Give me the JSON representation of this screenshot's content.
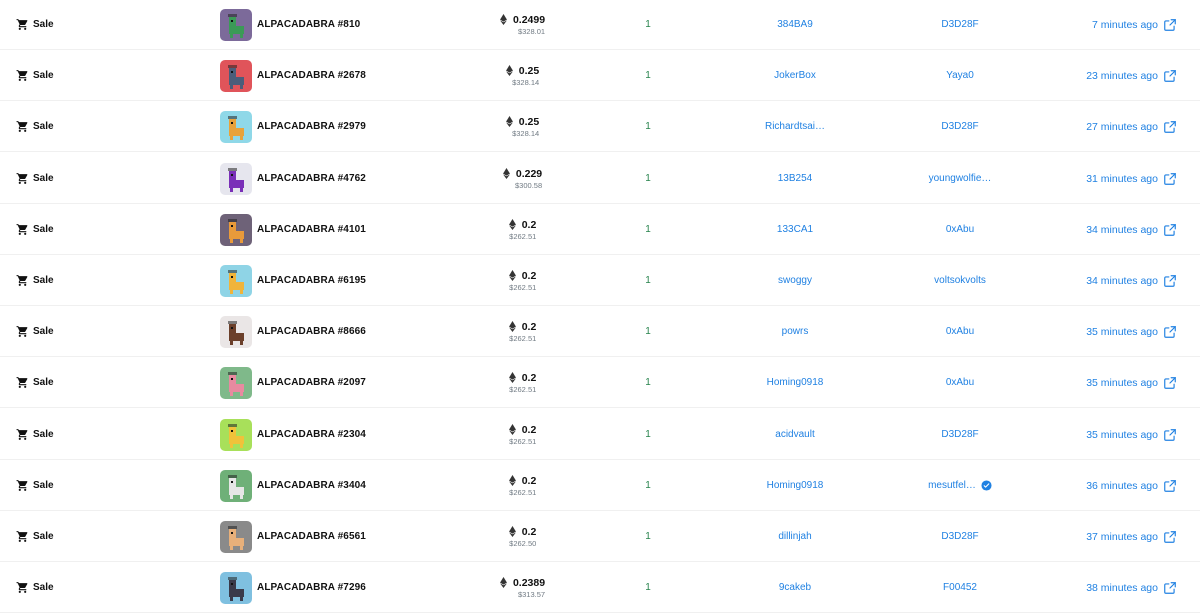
{
  "event_label": "Sale",
  "colors": {
    "link": "#2081e2",
    "quantity": "#27834c",
    "muted": "#707a83"
  },
  "icons": {
    "event": "cart-icon",
    "currency": "eth-icon",
    "external": "external-link-icon",
    "verified": "verified-badge-icon"
  },
  "rows": [
    {
      "item": "ALPACADABRA #810",
      "thumb_bg": "#7c6a9a",
      "body_color": "#3b9a57",
      "price_eth": "0.2499",
      "price_usd": "$328.01",
      "quantity": "1",
      "from": "384BA9",
      "to": "D3D28F",
      "verified_to": false,
      "time": "7 minutes ago"
    },
    {
      "item": "ALPACADABRA #2678",
      "thumb_bg": "#e0545a",
      "body_color": "#4b5d7a",
      "price_eth": "0.25",
      "price_usd": "$328.14",
      "quantity": "1",
      "from": "JokerBox",
      "to": "Yaya0",
      "verified_to": false,
      "time": "23 minutes ago"
    },
    {
      "item": "ALPACADABRA #2979",
      "thumb_bg": "#8fd8e8",
      "body_color": "#e8a23a",
      "price_eth": "0.25",
      "price_usd": "$328.14",
      "quantity": "1",
      "from": "Richardtsai…",
      "to": "D3D28F",
      "verified_to": false,
      "time": "27 minutes ago"
    },
    {
      "item": "ALPACADABRA #4762",
      "thumb_bg": "#e6e6ee",
      "body_color": "#7a2fb8",
      "price_eth": "0.229",
      "price_usd": "$300.58",
      "quantity": "1",
      "from": "13B254",
      "to": "youngwolfie…",
      "verified_to": false,
      "time": "31 minutes ago"
    },
    {
      "item": "ALPACADABRA #4101",
      "thumb_bg": "#6e6278",
      "body_color": "#e99a3a",
      "price_eth": "0.2",
      "price_usd": "$262.51",
      "quantity": "1",
      "from": "133CA1",
      "to": "0xAbu",
      "verified_to": false,
      "time": "34 minutes ago"
    },
    {
      "item": "ALPACADABRA #6195",
      "thumb_bg": "#8fd4e6",
      "body_color": "#f0b43a",
      "price_eth": "0.2",
      "price_usd": "$262.51",
      "quantity": "1",
      "from": "swoggy",
      "to": "voltsokvolts",
      "verified_to": false,
      "time": "34 minutes ago"
    },
    {
      "item": "ALPACADABRA #8666",
      "thumb_bg": "#eae6e6",
      "body_color": "#6b3f2a",
      "price_eth": "0.2",
      "price_usd": "$262.51",
      "quantity": "1",
      "from": "powrs",
      "to": "0xAbu",
      "verified_to": false,
      "time": "35 minutes ago"
    },
    {
      "item": "ALPACADABRA #2097",
      "thumb_bg": "#7fb98a",
      "body_color": "#e88aa0",
      "price_eth": "0.2",
      "price_usd": "$262.51",
      "quantity": "1",
      "from": "Homing0918",
      "to": "0xAbu",
      "verified_to": false,
      "time": "35 minutes ago"
    },
    {
      "item": "ALPACADABRA #2304",
      "thumb_bg": "#a8e05a",
      "body_color": "#f0c23a",
      "price_eth": "0.2",
      "price_usd": "$262.51",
      "quantity": "1",
      "from": "acidvault",
      "to": "D3D28F",
      "verified_to": false,
      "time": "35 minutes ago"
    },
    {
      "item": "ALPACADABRA #3404",
      "thumb_bg": "#6fb078",
      "body_color": "#e6e6e6",
      "price_eth": "0.2",
      "price_usd": "$262.51",
      "quantity": "1",
      "from": "Homing0918",
      "to": "mesutfel…",
      "verified_to": true,
      "time": "36 minutes ago"
    },
    {
      "item": "ALPACADABRA #6561",
      "thumb_bg": "#8a8a8a",
      "body_color": "#e8b07a",
      "price_eth": "0.2",
      "price_usd": "$262.50",
      "quantity": "1",
      "from": "dillinjah",
      "to": "D3D28F",
      "verified_to": false,
      "time": "37 minutes ago"
    },
    {
      "item": "ALPACADABRA #7296",
      "thumb_bg": "#7fc0e0",
      "body_color": "#3a3a4a",
      "price_eth": "0.2389",
      "price_usd": "$313.57",
      "quantity": "1",
      "from": "9cakeb",
      "to": "F00452",
      "verified_to": false,
      "time": "38 minutes ago"
    }
  ]
}
